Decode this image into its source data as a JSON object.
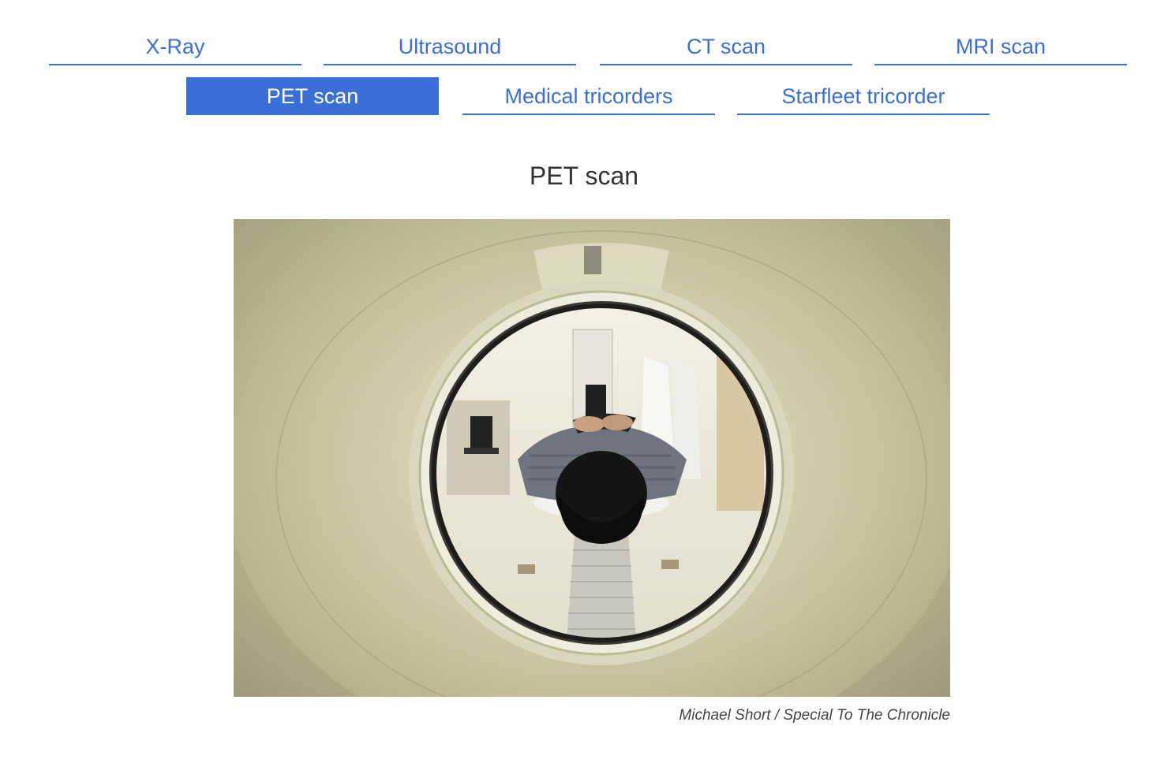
{
  "tabs": [
    {
      "label": "X-Ray",
      "active": false
    },
    {
      "label": "Ultrasound",
      "active": false
    },
    {
      "label": "CT scan",
      "active": false
    },
    {
      "label": "MRI scan",
      "active": false
    },
    {
      "label": "PET scan",
      "active": true
    },
    {
      "label": "Medical tricorders",
      "active": false
    },
    {
      "label": "Starfleet tricorder",
      "active": false
    }
  ],
  "content": {
    "title": "PET scan",
    "photo_credit": "Michael Short / Special To The Chronicle"
  },
  "colors": {
    "accent": "#3a6fd8",
    "title_text": "#333333",
    "credit_text": "#444444",
    "background": "#ffffff"
  }
}
